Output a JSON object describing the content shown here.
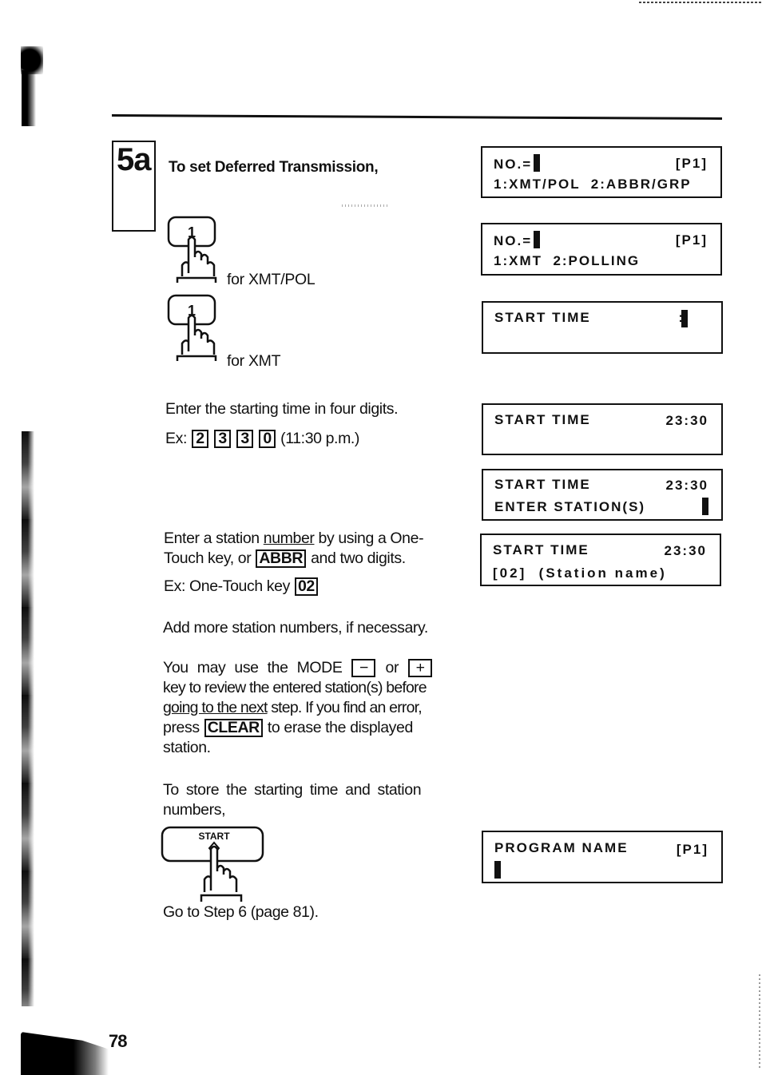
{
  "page": {
    "page_number": "78",
    "step_label": "5a",
    "heading": "To set Deferred Transmission,"
  },
  "instructions": {
    "press_1_label": "for XMT/POL",
    "press_1_key": "1",
    "press_1b_label": "for XMT",
    "press_1b_key": "1",
    "start_time_intro": "Enter the starting time in four digits.",
    "example_prefix": "Ex:",
    "example_keys": [
      "2",
      "3",
      "3",
      "0"
    ],
    "example_note": "(11:30 p.m.)",
    "station_line1_a": "Enter a station ",
    "station_line1_u": "number",
    "station_line1_b": " by using a One-",
    "station_line2_a": "Touch key, or ",
    "station_key_abbr": "ABBR",
    "station_line2_b": " and two digits.",
    "station_example_prefix": "Ex: One-Touch key ",
    "station_example_key": "02",
    "add_more": "Add more station numbers, if necessary.",
    "mode_line1_a": "You may use the MODE ",
    "mode_key_minus": "−",
    "mode_or": " or ",
    "mode_key_plus": "+",
    "mode_line2": "key to review the entered station(s) before",
    "mode_line3_u": "going to the next",
    "mode_line3_b": " step. If you find an error,",
    "mode_line4_a": "press ",
    "mode_key_clear": "CLEAR",
    "mode_line4_b": " to erase the displayed",
    "mode_line5": "station.",
    "store_line1": "To store the starting time and station",
    "store_line2": "numbers,",
    "start_key": "START",
    "go_to": "Go to Step 6 (page 81)."
  },
  "displays": [
    {
      "line1_left": "NO.=",
      "line1_cursor": true,
      "line1_right": "[P1]",
      "line2": "1:XMT/POL  2:ABBR/GRP"
    },
    {
      "line1_left": "NO.=",
      "line1_cursor": true,
      "line1_right": "[P1]",
      "line2": "1:XMT  2:POLLING"
    },
    {
      "line1_left": "START TIME",
      "line1_cursor": true,
      "line1_right": ":",
      "line2": ""
    },
    {
      "line1_left": "START TIME",
      "line1_right": "23:30",
      "line2": ""
    },
    {
      "line1_left": "START TIME",
      "line1_right": "23:30",
      "line2": "ENTER STATION(S)",
      "line2_cursor": true
    },
    {
      "line1_left": "START TIME",
      "line1_right": "23:30",
      "line2": "[02]  (Station name)"
    },
    {
      "line1_left": "PROGRAM NAME",
      "line1_right": "[P1]",
      "line2": "",
      "line2_cursor": true
    }
  ]
}
